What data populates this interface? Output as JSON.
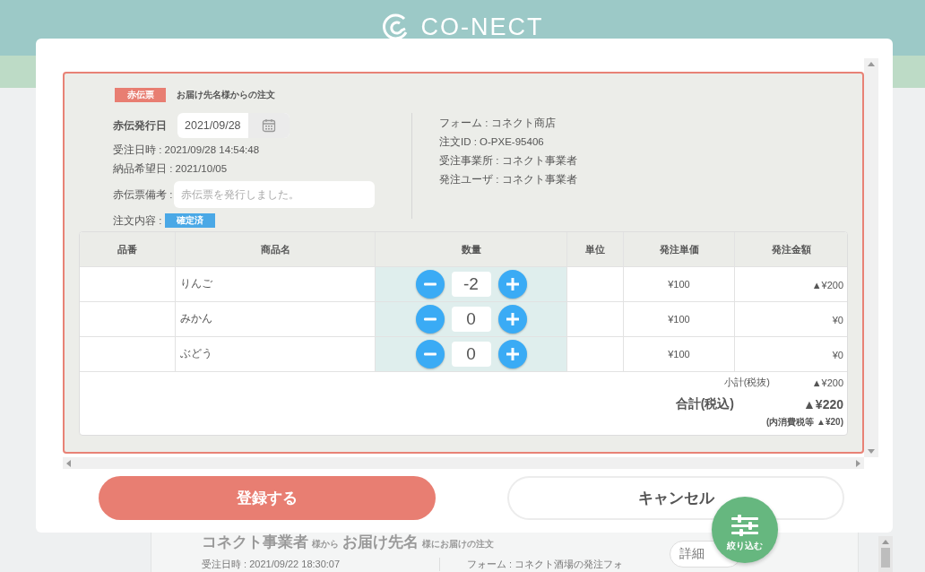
{
  "header": {
    "logo": "CO-NECT"
  },
  "background_card": {
    "title": "コネクト事業者",
    "title_suffix": "様から",
    "recipient": "お届け先名",
    "recipient_suffix": "様にお届けの注文",
    "order_time": "受注日時 : 2021/09/22 18:30:07",
    "form": "フォーム : コネクト酒場の発注フォ",
    "detail_button": "詳細"
  },
  "modal": {
    "tag": "赤伝票",
    "subtitle": "お届け先名様からの注文",
    "issue_date": {
      "label": "赤伝発行日",
      "value": "2021/09/28"
    },
    "info_left": [
      "受注日時 : 2021/09/28 14:54:48",
      "納品希望日 : 2021/10/05"
    ],
    "remark": {
      "label": "赤伝票備考 :",
      "placeholder": "赤伝票を発行しました。"
    },
    "status": {
      "label": "注文内容 :",
      "badge": "確定済"
    },
    "info_right": [
      "フォーム : コネクト商店",
      "注文ID : O-PXE-95406",
      "受注事業所 : コネクト事業者",
      "発注ユーザ : コネクト事業者"
    ],
    "table": {
      "columns": [
        "品番",
        "商品名",
        "数量",
        "単位",
        "発注単価",
        "発注金額"
      ],
      "rows": [
        {
          "name": "りんご",
          "quantity": "-2",
          "unit_price": "¥100",
          "amount": "▲¥200"
        },
        {
          "name": "みかん",
          "quantity": "0",
          "unit_price": "¥100",
          "amount": "¥0"
        },
        {
          "name": "ぶどう",
          "quantity": "0",
          "unit_price": "¥100",
          "amount": "¥0"
        }
      ]
    },
    "totals": {
      "subtotal_label": "小計(税抜)",
      "subtotal": "▲¥200",
      "total_label": "合計(税込)",
      "total": "▲¥220",
      "tax_note": "(内消費税等 ▲¥20)"
    },
    "buttons": [
      {
        "label": "登録する",
        "kind": "primary"
      },
      {
        "label": "キャンセル",
        "kind": "secondary"
      }
    ]
  },
  "filter_button": {
    "label": "絞り込む"
  }
}
